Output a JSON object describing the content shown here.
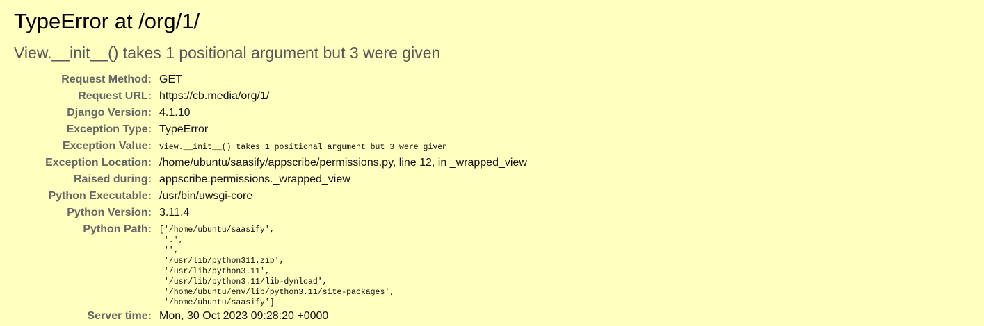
{
  "page": {
    "title": "TypeError at /org/1/",
    "exception_message": "View.__init__() takes 1 positional argument but 3 were given"
  },
  "meta": {
    "request_method": {
      "label": "Request Method:",
      "value": "GET"
    },
    "request_url": {
      "label": "Request URL:",
      "value": "https://cb.media/org/1/"
    },
    "django_version": {
      "label": "Django Version:",
      "value": "4.1.10"
    },
    "exception_type": {
      "label": "Exception Type:",
      "value": "TypeError"
    },
    "exception_value": {
      "label": "Exception Value:",
      "value": "View.__init__() takes 1 positional argument but 3 were given"
    },
    "exception_location": {
      "label": "Exception Location:",
      "value": "/home/ubuntu/saasify/appscribe/permissions.py, line 12, in _wrapped_view"
    },
    "raised_during": {
      "label": "Raised during:",
      "value": "appscribe.permissions._wrapped_view"
    },
    "python_executable": {
      "label": "Python Executable:",
      "value": "/usr/bin/uwsgi-core"
    },
    "python_version": {
      "label": "Python Version:",
      "value": "3.11.4"
    },
    "python_path": {
      "label": "Python Path:",
      "lines": [
        "['/home/ubuntu/saasify',",
        " '.',",
        " '',",
        " '/usr/lib/python311.zip',",
        " '/usr/lib/python3.11',",
        " '/usr/lib/python3.11/lib-dynload',",
        " '/home/ubuntu/env/lib/python3.11/site-packages',",
        " '/home/ubuntu/saasify']"
      ]
    },
    "server_time": {
      "label": "Server time:",
      "value": "Mon, 30 Oct 2023 09:28:20 +0000"
    }
  }
}
